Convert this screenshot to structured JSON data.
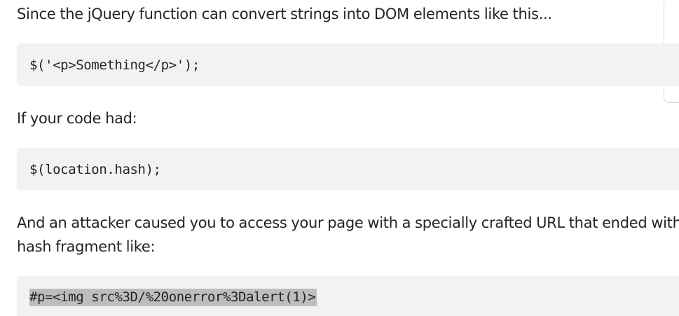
{
  "article": {
    "p1": "Since the jQuery function can convert strings into DOM elements like this...",
    "code1": "$('<p>Something</p>');",
    "p2": "If your code had:",
    "code2": "$(location.hash);",
    "p3_line1": "And an attacker caused you to access your page with a specially crafted URL that ended with a",
    "p3_line2": "hash fragment like:",
    "code3": "#p=<img src%3D/%20onerror%3Dalert(1)>"
  }
}
